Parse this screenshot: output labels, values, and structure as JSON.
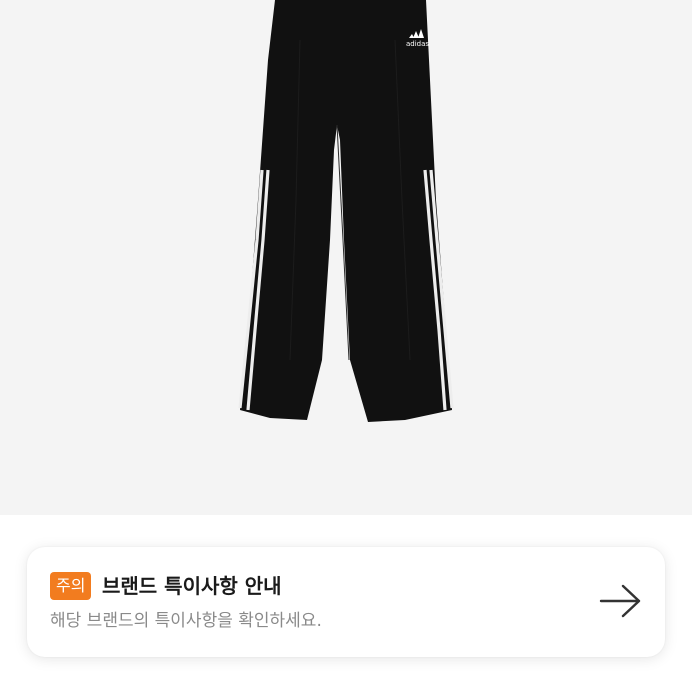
{
  "product_image": {
    "brand_logo_text": "adidas",
    "colors": {
      "background": "#f4f4f4",
      "pants": "#111111",
      "stripes": "#f2f2f2"
    }
  },
  "notice": {
    "badge": "주의",
    "title": "브랜드 특이사항 안내",
    "description": "해당 브랜드의 특이사항을 확인하세요.",
    "arrow_icon": "arrow-right-icon",
    "colors": {
      "badge": "#f27c1f"
    }
  }
}
